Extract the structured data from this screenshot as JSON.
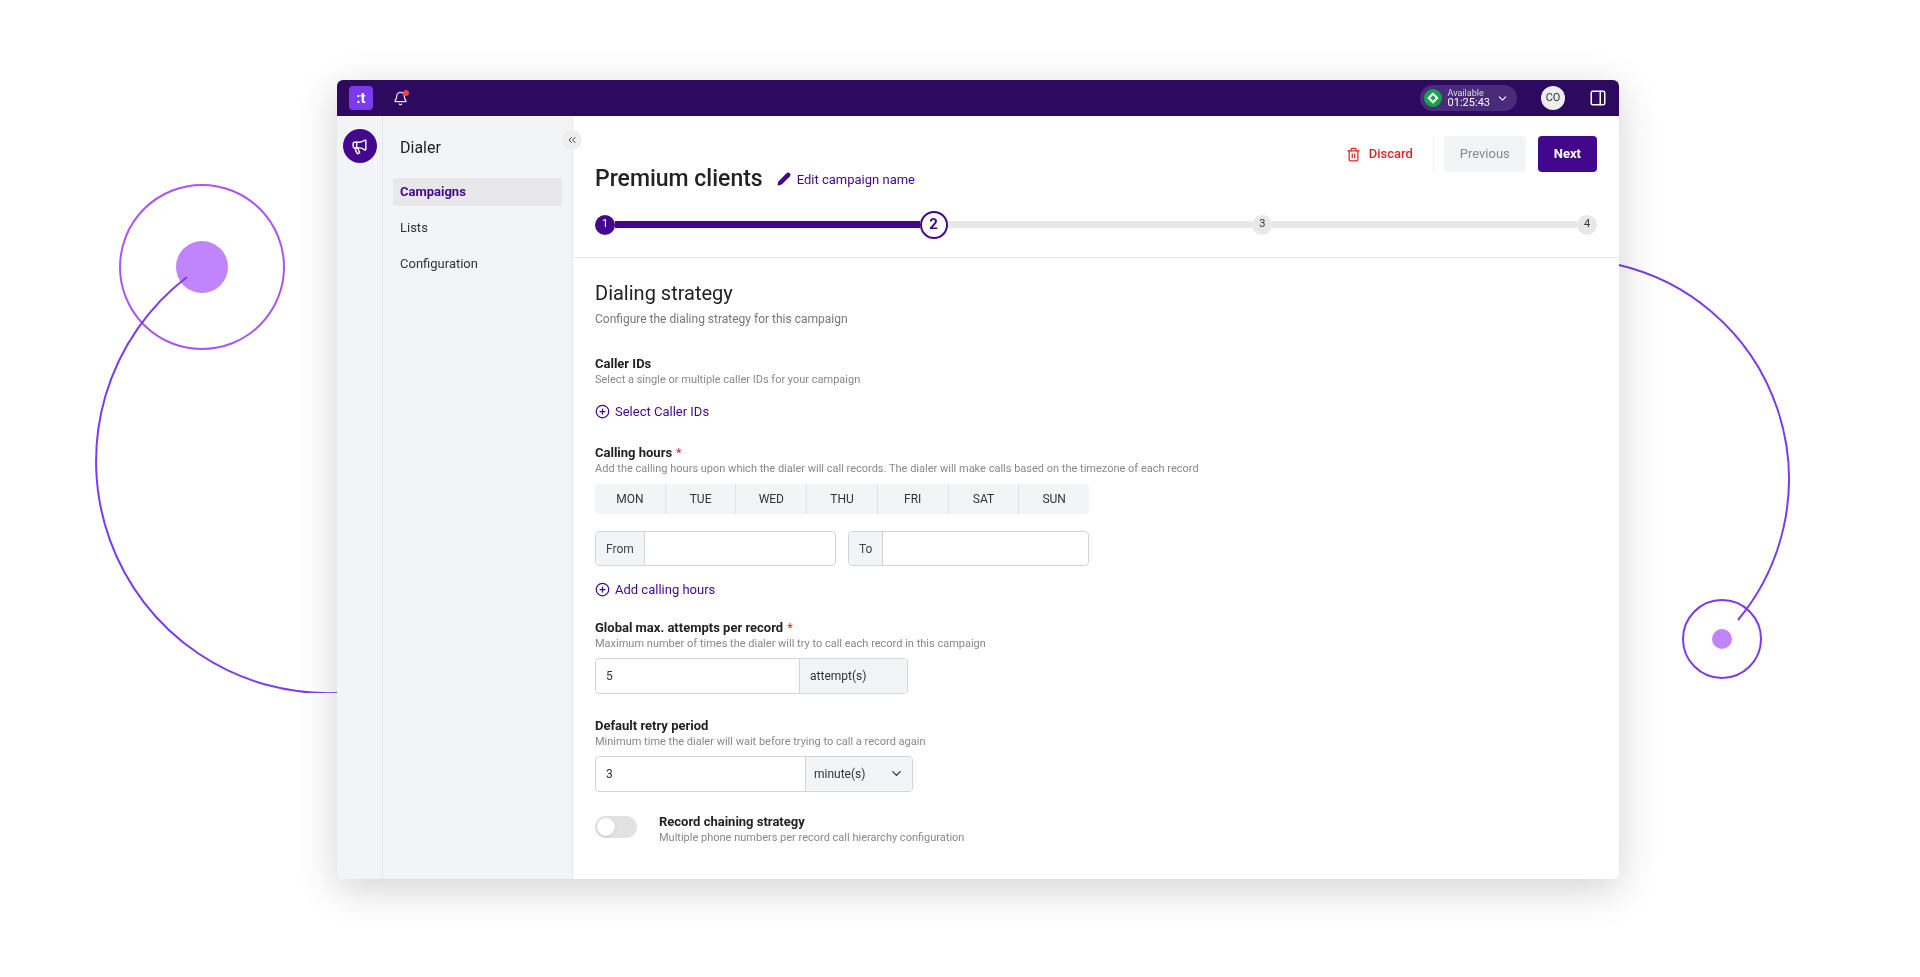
{
  "topbar": {
    "logo": ":t",
    "status": {
      "label": "Available",
      "time": "01:25:43",
      "color": "#16a34a"
    },
    "avatar": "CO"
  },
  "sidebar": {
    "title": "Dialer",
    "items": [
      {
        "label": "Campaigns",
        "selected": true
      },
      {
        "label": "Lists",
        "selected": false
      },
      {
        "label": "Configuration",
        "selected": false
      }
    ]
  },
  "header": {
    "title": "Premium clients",
    "edit_link": "Edit campaign name",
    "actions": {
      "discard": "Discard",
      "previous": "Previous",
      "next": "Next"
    }
  },
  "steps": [
    {
      "label": "1",
      "completed": true,
      "current": false
    },
    {
      "label": "2",
      "completed": false,
      "current": true
    },
    {
      "label": "3",
      "completed": false,
      "current": false
    },
    {
      "label": "4",
      "completed": false,
      "current": false
    }
  ],
  "section": {
    "title": "Dialing strategy",
    "subtitle": "Configure the dialing strategy for this campaign"
  },
  "caller_ids": {
    "label": "Caller IDs",
    "hint": "Select a single or multiple caller IDs for your campaign",
    "action": "Select Caller IDs"
  },
  "calling_hours": {
    "label": "Calling hours",
    "required_mark": "*",
    "hint": "Add the calling hours upon which the dialer will call records. The dialer will make calls based on the timezone of each record",
    "days": [
      {
        "label": "MON",
        "selected": false
      },
      {
        "label": "TUE",
        "selected": false
      },
      {
        "label": "WED",
        "selected": false
      },
      {
        "label": "THU",
        "selected": false
      },
      {
        "label": "FRI",
        "selected": false
      },
      {
        "label": "SAT",
        "selected": false
      },
      {
        "label": "SUN",
        "selected": false
      }
    ],
    "from_label": "From",
    "to_label": "To",
    "action": "Add calling hours"
  },
  "max_attempts": {
    "label": "Global max. attempts per record",
    "required_mark": "*",
    "hint": "Maximum number of times the dialer will try to call each record in this campaign",
    "value": "5",
    "unit": "attempt(s)"
  },
  "retry": {
    "label": "Default retry period",
    "hint": "Minimum time the dialer will wait before trying to call a record again",
    "value": "3",
    "unit": "minute(s)"
  },
  "chaining": {
    "label": "Record chaining strategy",
    "hint": "Multiple phone numbers per record call hierarchy configuration",
    "on": false
  }
}
